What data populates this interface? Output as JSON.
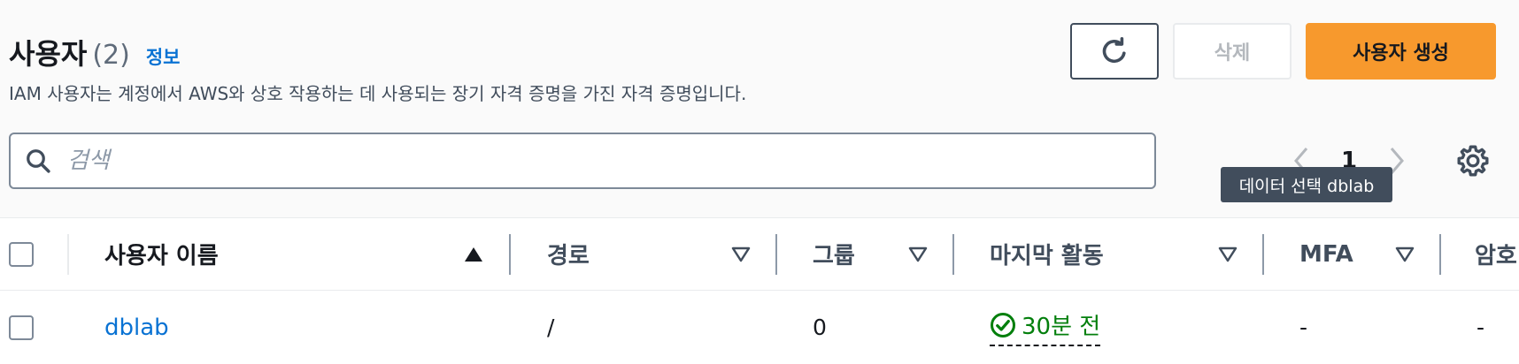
{
  "header": {
    "title": "사용자",
    "count": "(2)",
    "info": "정보",
    "description": "IAM 사용자는 계정에서 AWS와 상호 작용하는 데 사용되는 장기 자격 증명을 가진 자격 증명입니다."
  },
  "actions": {
    "refresh_icon": "refresh-icon",
    "delete_label": "삭제",
    "create_label": "사용자 생성"
  },
  "search": {
    "placeholder": "검색",
    "value": ""
  },
  "pagination": {
    "current_page": "1"
  },
  "tooltip": {
    "text": "데이터 선택 dblab"
  },
  "table": {
    "columns": [
      "사용자 이름",
      "경로",
      "그룹",
      "마지막 활동",
      "MFA",
      "암호"
    ],
    "rows": [
      {
        "user_name": "dblab",
        "path": "/",
        "groups": "0",
        "last_activity": "30분 전",
        "mfa": "-",
        "password": "-"
      }
    ]
  },
  "colors": {
    "accent": "#0972d3",
    "primary_button": "#f7992d",
    "success": "#037f0c"
  }
}
